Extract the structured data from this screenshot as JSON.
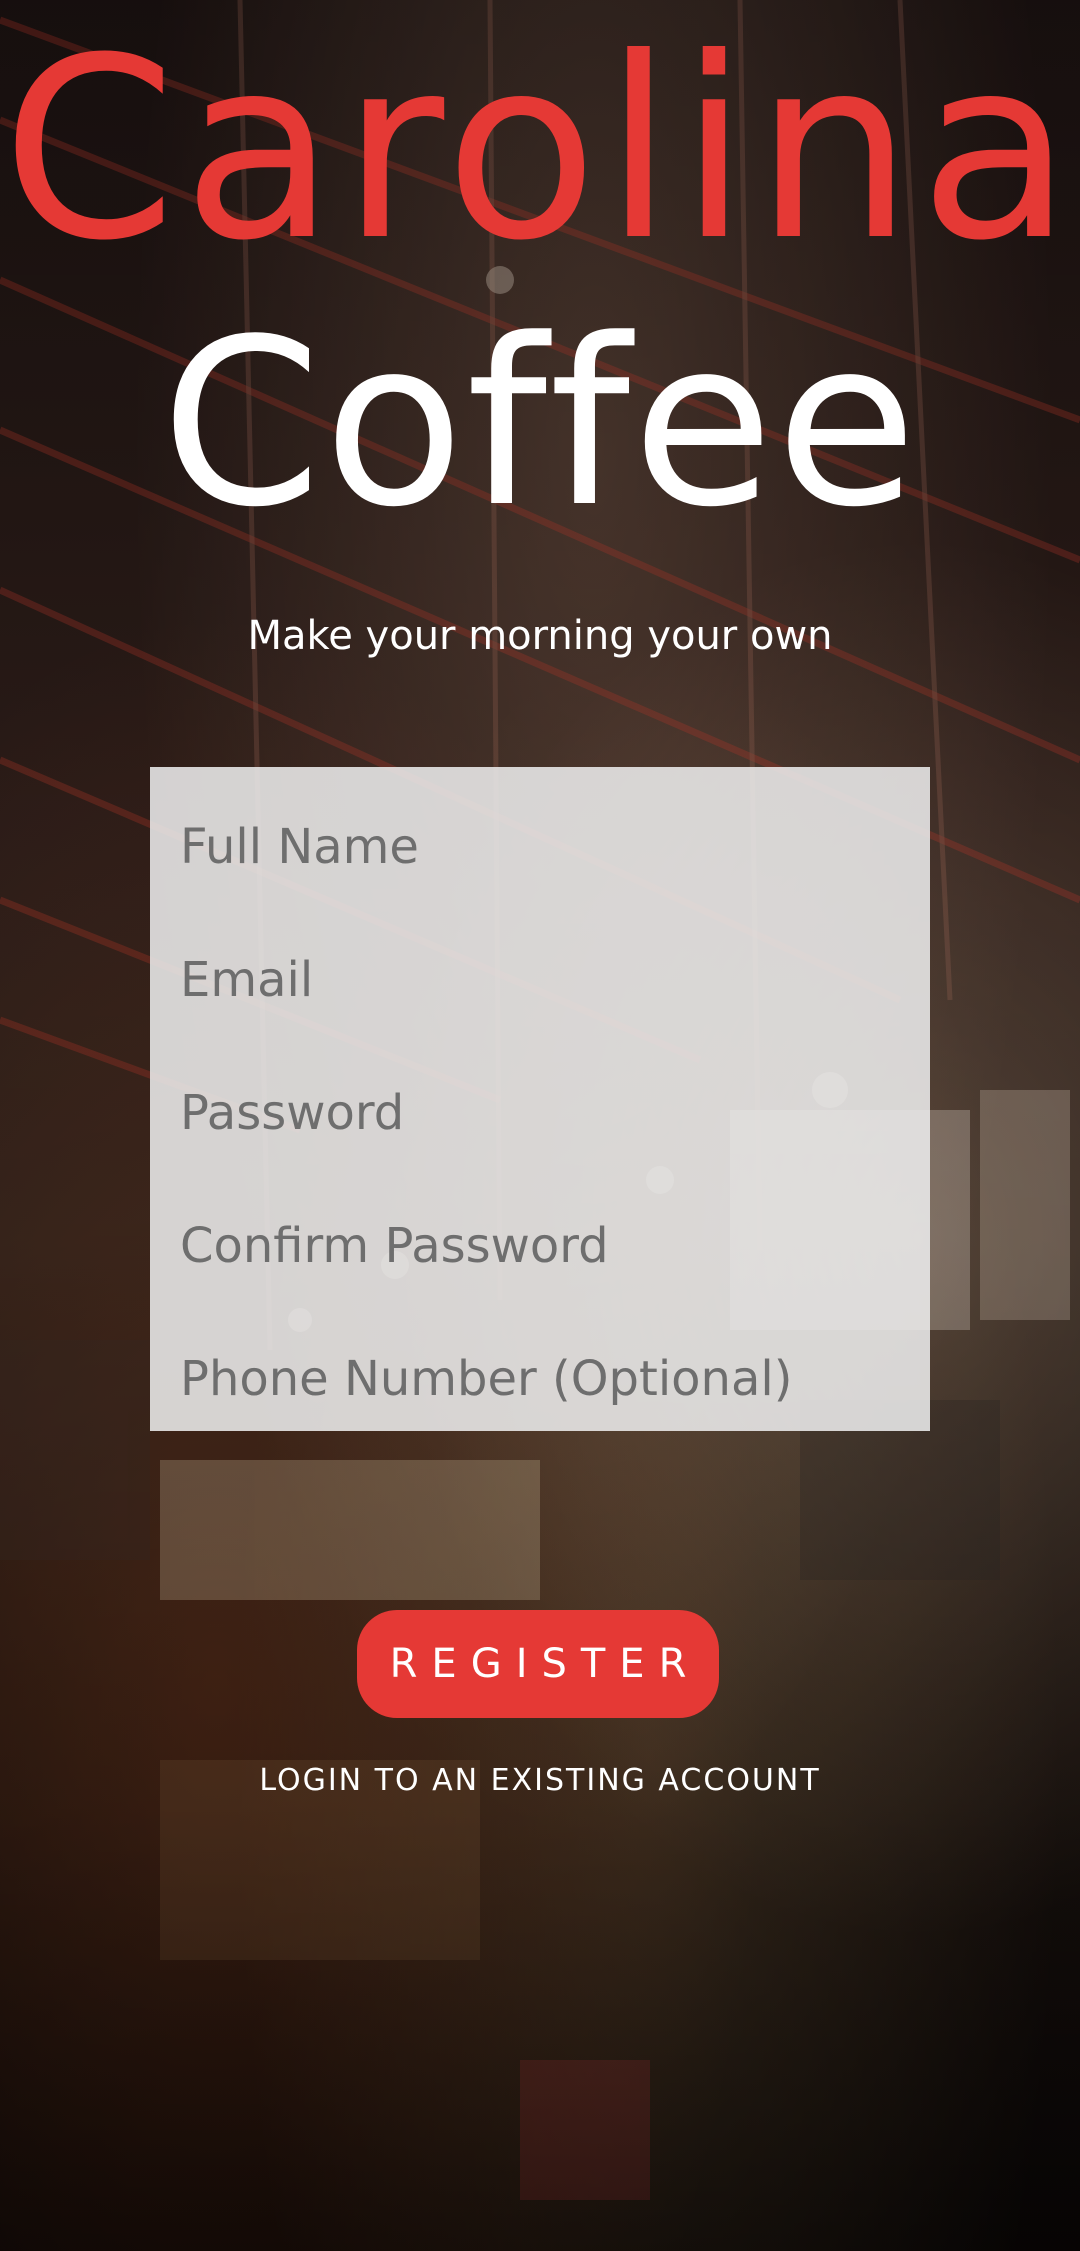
{
  "brand": {
    "title_primary": "Carolina",
    "title_secondary": "Coffee",
    "tagline": "Make your morning your own"
  },
  "form": {
    "full_name_placeholder": "Full Name",
    "email_placeholder": "Email",
    "password_placeholder": "Password",
    "confirm_password_placeholder": "Confirm Password",
    "phone_placeholder": "Phone Number (Optional)"
  },
  "actions": {
    "register_label": "REGISTER",
    "login_label": "LOGIN TO AN EXISTING ACCOUNT"
  },
  "colors": {
    "accent": "#e53935",
    "text_light": "#ffffff",
    "placeholder": "#6e6e6e",
    "card": "#ececec"
  }
}
